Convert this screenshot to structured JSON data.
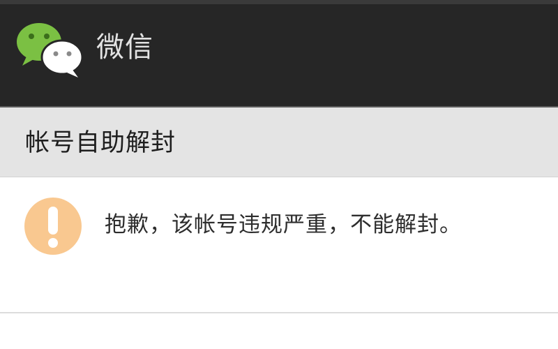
{
  "header": {
    "app_title": "微信",
    "logo_icon": "wechat-logo-icon"
  },
  "section": {
    "title": "帐号自助解封"
  },
  "notice": {
    "icon": "warning-icon",
    "message": "抱歉，该帐号违规严重，不能解封。"
  },
  "colors": {
    "header_bg": "#262626",
    "section_bg": "#e4e4e4",
    "wechat_green": "#7bc043",
    "warning_orange": "#f9c890"
  }
}
